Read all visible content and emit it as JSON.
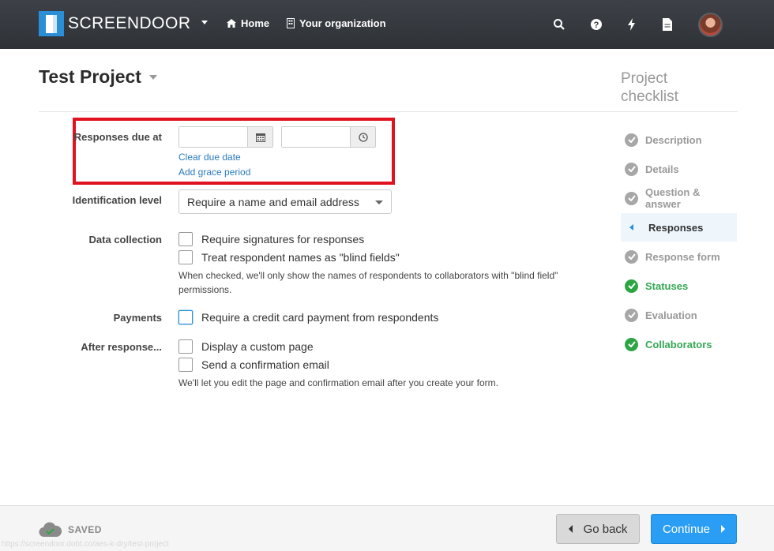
{
  "nav": {
    "brand": "SCREENDOOR",
    "home": "Home",
    "organization": "Your organization",
    "icons": [
      "search-icon",
      "help-icon",
      "bolt-icon",
      "document-icon"
    ]
  },
  "project": {
    "title": "Test Project"
  },
  "form": {
    "responses_due_label": "Responses due at",
    "date_value": "",
    "time_value": "",
    "clear_due_date": "Clear due date",
    "add_grace_period": "Add grace period",
    "identification_label": "Identification level",
    "identification_value": "Require a name and email address",
    "data_collection_label": "Data collection",
    "require_signatures": "Require signatures for responses",
    "blind_fields": "Treat respondent names as \"blind fields\"",
    "blind_help_line1": "When checked, we'll only show the names of respondents to collaborators with \"blind field\"",
    "blind_help_line2": "permissions.",
    "payments_label": "Payments",
    "credit_card": "Require a credit card payment from respondents",
    "after_response_label": "After response...",
    "custom_page": "Display a custom page",
    "confirmation_email": "Send a confirmation email",
    "after_help": "We'll let you edit the page and confirmation email after you create your form."
  },
  "checklist": {
    "title_line1": "Project",
    "title_line2": "checklist",
    "items": [
      {
        "label": "Description",
        "state": "pending"
      },
      {
        "label": "Details",
        "state": "pending"
      },
      {
        "label": "Question & answer",
        "state": "pending"
      },
      {
        "label": "Responses",
        "state": "active"
      },
      {
        "label": "Response form",
        "state": "pending"
      },
      {
        "label": "Statuses",
        "state": "done"
      },
      {
        "label": "Evaluation",
        "state": "pending"
      },
      {
        "label": "Collaborators",
        "state": "done"
      }
    ]
  },
  "footer": {
    "saved": "SAVED",
    "go_back": "Go back",
    "continue": "Continue",
    "status_url": "https://screendoor.dobt.co/aes-k-dry/test-project"
  },
  "colors": {
    "accent": "#2a9df4",
    "highlight": "#e0121f",
    "done": "#2ea543",
    "nav_bg": "#33363b"
  }
}
